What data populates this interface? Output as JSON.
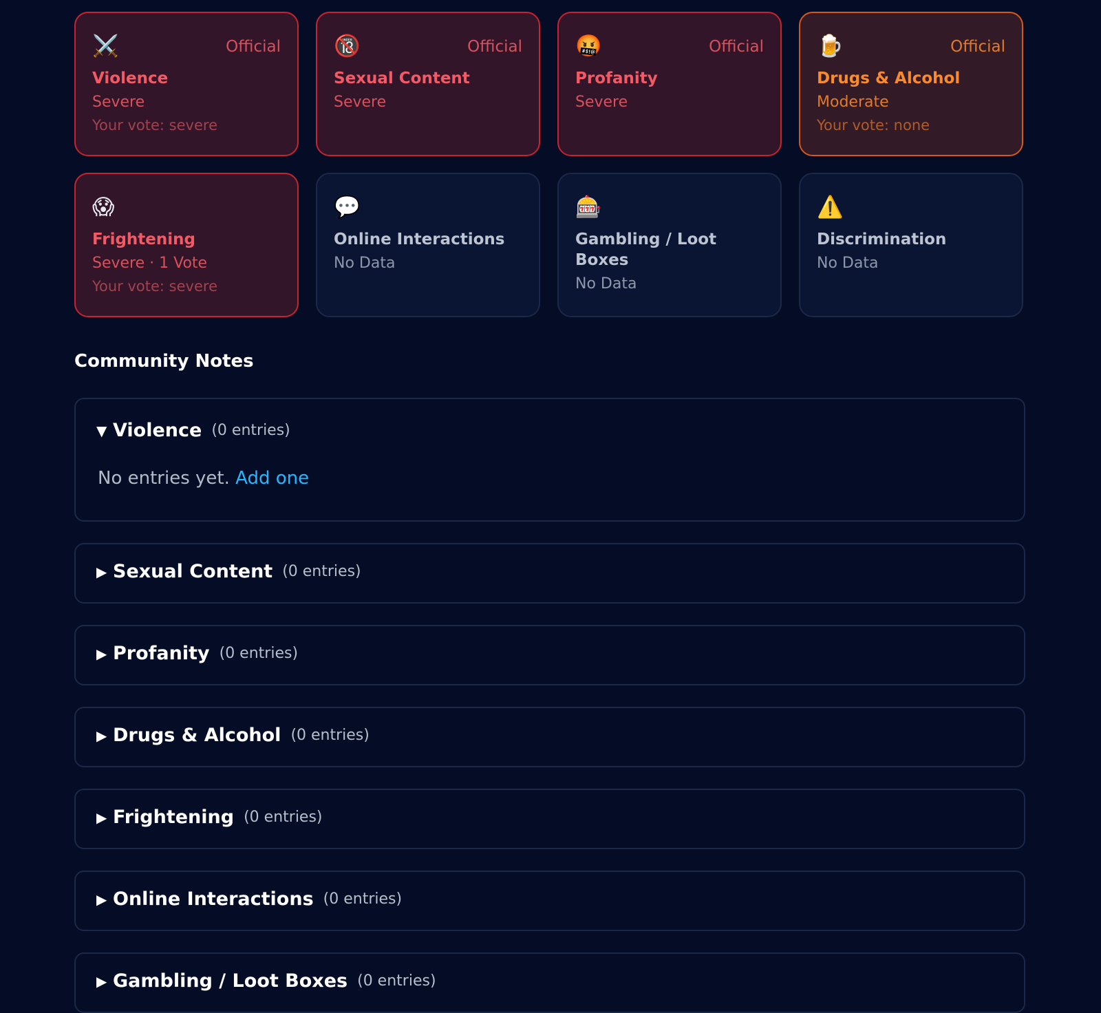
{
  "cards": [
    {
      "icon": "⚔️",
      "icon_name": "crossed-swords-icon",
      "official": "Official",
      "title": "Violence",
      "severity": "Severe",
      "vote": "Your vote: severe",
      "tone": "red"
    },
    {
      "icon": "🔞",
      "icon_name": "no-under-18-icon",
      "official": "Official",
      "title": "Sexual Content",
      "severity": "Severe",
      "vote": "",
      "tone": "red"
    },
    {
      "icon": "🤬",
      "icon_name": "cursing-face-icon",
      "official": "Official",
      "title": "Profanity",
      "severity": "Severe",
      "vote": "",
      "tone": "red"
    },
    {
      "icon": "🍺",
      "icon_name": "beer-mug-icon",
      "official": "Official",
      "title": "Drugs & Alcohol",
      "severity": "Moderate",
      "vote": "Your vote: none",
      "tone": "orange"
    },
    {
      "icon": "😱",
      "icon_name": "screaming-face-icon",
      "official": "",
      "title": "Frightening",
      "severity": "Severe · 1 Vote",
      "vote": "Your vote: severe",
      "tone": "red"
    },
    {
      "icon": "💬",
      "icon_name": "speech-bubble-icon",
      "official": "",
      "title": "Online Interactions",
      "severity": "No Data",
      "vote": "",
      "tone": "neutral"
    },
    {
      "icon": "🎰",
      "icon_name": "slot-machine-icon",
      "official": "",
      "title": "Gambling / Loot Boxes",
      "severity": "No Data",
      "vote": "",
      "tone": "neutral"
    },
    {
      "icon": "⚠️",
      "icon_name": "warning-icon",
      "official": "",
      "title": "Discrimination",
      "severity": "No Data",
      "vote": "",
      "tone": "neutral"
    }
  ],
  "community_notes": {
    "heading": "Community Notes",
    "empty_text": "No entries yet.",
    "add_link": "Add one",
    "sections": [
      {
        "name": "Violence",
        "count": "(0 entries)",
        "expanded": true
      },
      {
        "name": "Sexual Content",
        "count": "(0 entries)",
        "expanded": false
      },
      {
        "name": "Profanity",
        "count": "(0 entries)",
        "expanded": false
      },
      {
        "name": "Drugs & Alcohol",
        "count": "(0 entries)",
        "expanded": false
      },
      {
        "name": "Frightening",
        "count": "(0 entries)",
        "expanded": false
      },
      {
        "name": "Online Interactions",
        "count": "(0 entries)",
        "expanded": false
      },
      {
        "name": "Gambling / Loot Boxes",
        "count": "(0 entries)",
        "expanded": false
      }
    ]
  },
  "colors": {
    "background": "#050d26",
    "severe": "#f35a66",
    "moderate": "#f98b2e",
    "link": "#22b8ff"
  }
}
